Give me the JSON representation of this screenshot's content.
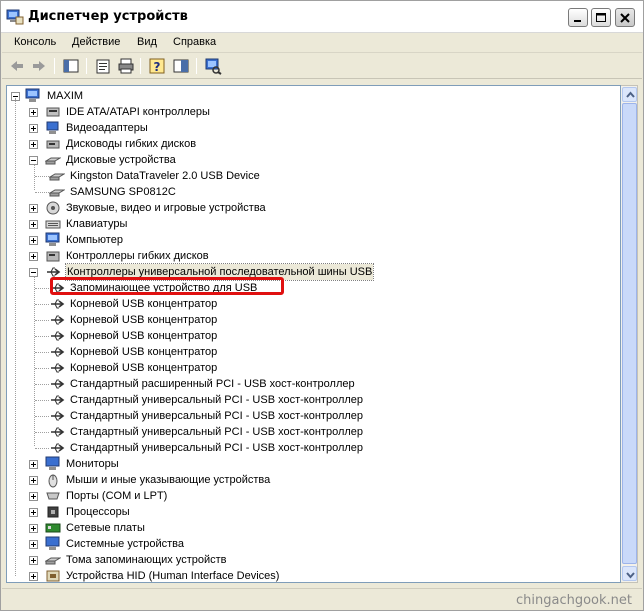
{
  "window": {
    "title": "Диспетчер устройств"
  },
  "menu": [
    {
      "label": "Консоль"
    },
    {
      "label": "Действие"
    },
    {
      "label": "Вид"
    },
    {
      "label": "Справка"
    }
  ],
  "tree": {
    "root": "MAXIM",
    "categories": [
      {
        "label": "IDE ATA/ATAPI контроллеры",
        "icon": "ide-controller-icon"
      },
      {
        "label": "Видеоадаптеры",
        "icon": "video-adapter-icon"
      },
      {
        "label": "Дисководы гибких дисков",
        "icon": "floppy-drive-icon"
      },
      {
        "label": "Дисковые устройства",
        "icon": "disk-drive-icon",
        "expanded": true,
        "children": [
          "Kingston DataTraveler 2.0 USB Device",
          "SAMSUNG SP0812C"
        ]
      },
      {
        "label": "Звуковые, видео и игровые устройства",
        "icon": "sound-icon"
      },
      {
        "label": "Клавиатуры",
        "icon": "keyboard-icon"
      },
      {
        "label": "Компьютер",
        "icon": "computer-icon"
      },
      {
        "label": "Контроллеры гибких дисков",
        "icon": "floppy-controller-icon"
      },
      {
        "label": "Контроллеры универсальной последовательной шины USB",
        "icon": "usb-icon",
        "expanded": true,
        "selected": true,
        "children": [
          "Запоминающее устройство для USB",
          "Корневой USB концентратор",
          "Корневой USB концентратор",
          "Корневой USB концентратор",
          "Корневой USB концентратор",
          "Корневой USB концентратор",
          "Стандартный расширенный PCI - USB хост-контроллер",
          "Стандартный универсальный PCI - USB хост-контроллер",
          "Стандартный универсальный PCI - USB хост-контроллер",
          "Стандартный универсальный PCI - USB хост-контроллер",
          "Стандартный универсальный PCI - USB хост-контроллер"
        ]
      },
      {
        "label": "Мониторы",
        "icon": "monitor-icon"
      },
      {
        "label": "Мыши и иные указывающие устройства",
        "icon": "mouse-icon"
      },
      {
        "label": "Порты (COM и LPT)",
        "icon": "port-icon"
      },
      {
        "label": "Процессоры",
        "icon": "processor-icon"
      },
      {
        "label": "Сетевые платы",
        "icon": "network-card-icon"
      },
      {
        "label": "Системные устройства",
        "icon": "system-device-icon"
      },
      {
        "label": "Тома запоминающих устройств",
        "icon": "storage-volume-icon"
      },
      {
        "label": "Устройства HID (Human Interface Devices)",
        "icon": "hid-icon"
      }
    ]
  },
  "watermark": "chingachgook.net",
  "colors": {
    "highlight": "#e01010",
    "selection": "#ece9d8",
    "chrome": "#ece9d8"
  }
}
